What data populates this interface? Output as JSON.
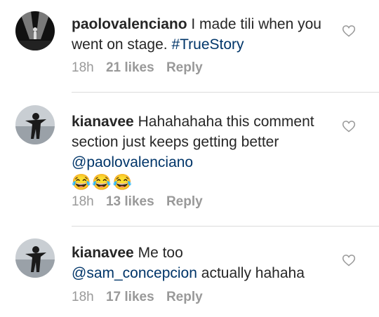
{
  "comments": [
    {
      "username": "paolovalenciano",
      "text": "I made tili when you went on stage.",
      "hashtag": "#TrueStory",
      "time": "18h",
      "likes": "21 likes",
      "reply": "Reply",
      "avatar_icon": "stage-performer-avatar-icon"
    },
    {
      "username": "kianavee",
      "text": "Hahahahaha this comment section just keeps getting better",
      "mention": "@paolovalenciano",
      "emoji": "😂😂😂",
      "time": "18h",
      "likes": "13 likes",
      "reply": "Reply",
      "avatar_icon": "person-silhouette-avatar-icon"
    },
    {
      "username": "kianavee",
      "text": "Me too",
      "mention": "@sam_concepcion",
      "text_after": "actually hahaha",
      "time": "18h",
      "likes": "17 likes",
      "reply": "Reply",
      "avatar_icon": "person-silhouette-avatar-icon"
    }
  ],
  "colors": {
    "text": "#262626",
    "link": "#003569",
    "meta": "#999999",
    "divider": "#dbdbdb"
  }
}
